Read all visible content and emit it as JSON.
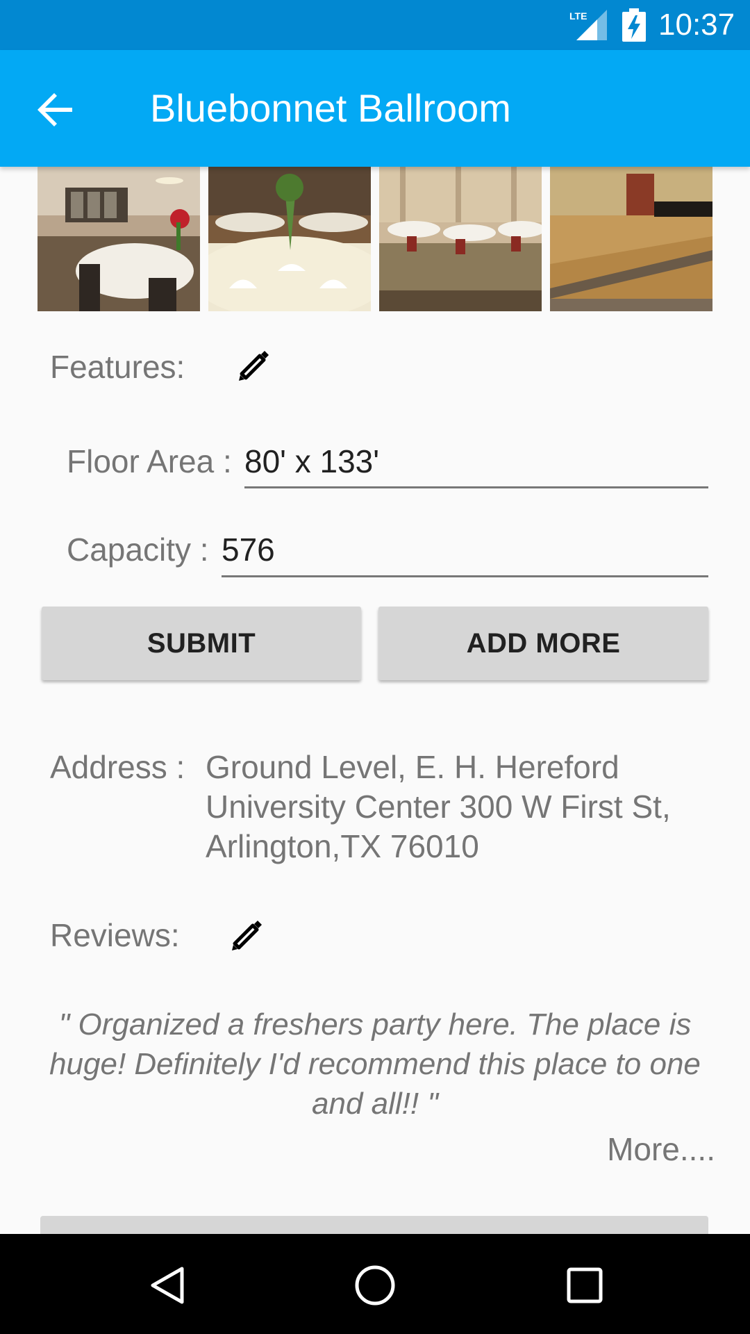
{
  "status_bar": {
    "network": "LTE",
    "time": "10:37"
  },
  "app_bar": {
    "title": "Bluebonnet Ballroom",
    "back_icon": "arrow-left-icon"
  },
  "gallery": {
    "photos": [
      {
        "name": "ballroom-photo-1"
      },
      {
        "name": "ballroom-photo-2"
      },
      {
        "name": "ballroom-photo-3"
      },
      {
        "name": "ballroom-photo-4"
      }
    ]
  },
  "features": {
    "label": "Features:",
    "edit_icon": "pencil-icon",
    "floor_area_label": "Floor Area :",
    "floor_area_value": "80' x 133'",
    "capacity_label": "Capacity :",
    "capacity_value": "576"
  },
  "buttons": {
    "submit": "SUBMIT",
    "add_more": "ADD MORE"
  },
  "address": {
    "label": "Address :",
    "value": "Ground Level, E. H. Hereford University Center 300 W First St, Arlington,TX 76010"
  },
  "reviews": {
    "label": "Reviews:",
    "edit_icon": "pencil-icon",
    "text": "\" Organized a freshers party here. The place is huge! Definitely I'd recommend this place to one and all!!  \"",
    "more": "More...."
  },
  "nav_bar": {
    "icons": [
      "back-triangle-icon",
      "home-circle-icon",
      "recents-square-icon"
    ]
  },
  "colors": {
    "status_bar": "#0288d1",
    "app_bar": "#03a9f4",
    "button": "#d6d6d6"
  }
}
